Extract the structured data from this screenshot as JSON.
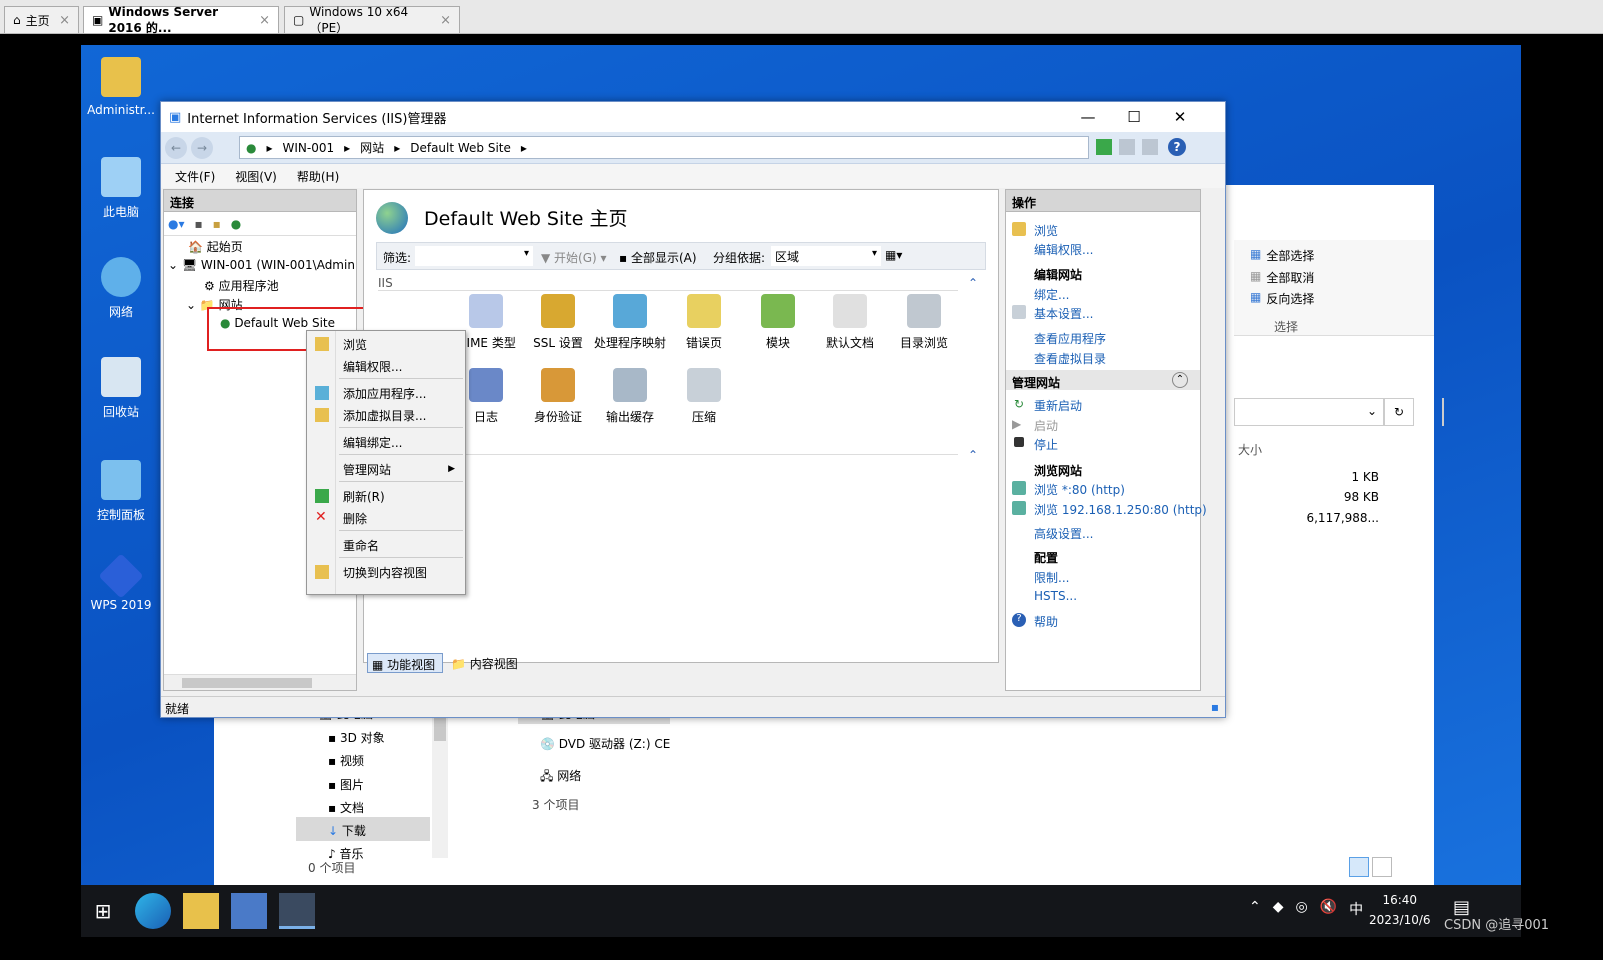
{
  "host_tabs": [
    {
      "label": "主页"
    },
    {
      "label": "Windows Server 2016 的..."
    },
    {
      "label": "Windows 10 x64（PE）"
    }
  ],
  "desktop_icons": [
    {
      "label": "Administr..."
    },
    {
      "label": "此电脑"
    },
    {
      "label": "网络"
    },
    {
      "label": "回收站"
    },
    {
      "label": "控制面板"
    },
    {
      "label": "WPS 2019"
    }
  ],
  "iis": {
    "title": "Internet Information Services (IIS)管理器",
    "breadcrumb": [
      "WIN-001",
      "网站",
      "Default Web Site"
    ],
    "menu": [
      "文件(F)",
      "视图(V)",
      "帮助(H)"
    ],
    "connections_header": "连接",
    "tree": [
      "起始页",
      "WIN-001 (WIN-001\\Admin",
      "应用程序池",
      "网站",
      "Default Web Site"
    ],
    "main_title": "Default Web Site 主页",
    "filter_label": "筛选:",
    "start_label": "开始(G)",
    "show_all_label": "全部显示(A)",
    "group_label": "分组依据:",
    "group_value": "区域",
    "section_iis": "IIS",
    "features": [
      "MIME 类型",
      "SSL 设置",
      "处理程序映射",
      "错误页",
      "模块",
      "默认文档",
      "目录浏览",
      "日志",
      "身份验证",
      "输出缓存",
      "压缩"
    ],
    "view_tabs": [
      "功能视图",
      "内容视图"
    ],
    "status": "就绪",
    "actions_header": "操作",
    "actions": {
      "browse": "浏览",
      "edit_perm": "编辑权限...",
      "edit_site": "编辑网站",
      "bind": "绑定...",
      "basic": "基本设置...",
      "view_apps": "查看应用程序",
      "view_vdirs": "查看虚拟目录",
      "manage_site": "管理网站",
      "restart": "重新启动",
      "start": "启动",
      "stop": "停止",
      "browse_site": "浏览网站",
      "browse80": "浏览 *:80 (http)",
      "browse_ip": "浏览 192.168.1.250:80 (http)",
      "advanced": "高级设置...",
      "config": "配置",
      "limits": "限制...",
      "hsts": "HSTS...",
      "help": "帮助"
    }
  },
  "context_menu": [
    "浏览",
    "编辑权限...",
    "添加应用程序...",
    "添加虚拟目录...",
    "编辑绑定...",
    "管理网站",
    "刷新(R)",
    "删除",
    "重命名",
    "切换到内容视图"
  ],
  "explorer": {
    "ribbon": [
      "全部选择",
      "全部取消",
      "反向选择"
    ],
    "ribbon_group": "选择",
    "size_header": "大小",
    "sizes": [
      "1 KB",
      "98 KB",
      "6,117,988..."
    ],
    "nav": [
      "此电脑",
      "3D 对象",
      "视频",
      "图片",
      "文档",
      "下载",
      "音乐"
    ],
    "items": [
      "此电脑",
      "DVD 驱动器 (Z:) CES",
      "网络"
    ],
    "count_left": "0 个项目",
    "count_right": "3 个项目"
  },
  "taskbar": {
    "time": "16:40",
    "date": "2023/10/6",
    "ime": "中"
  },
  "watermark": "CSDN @追寻001"
}
